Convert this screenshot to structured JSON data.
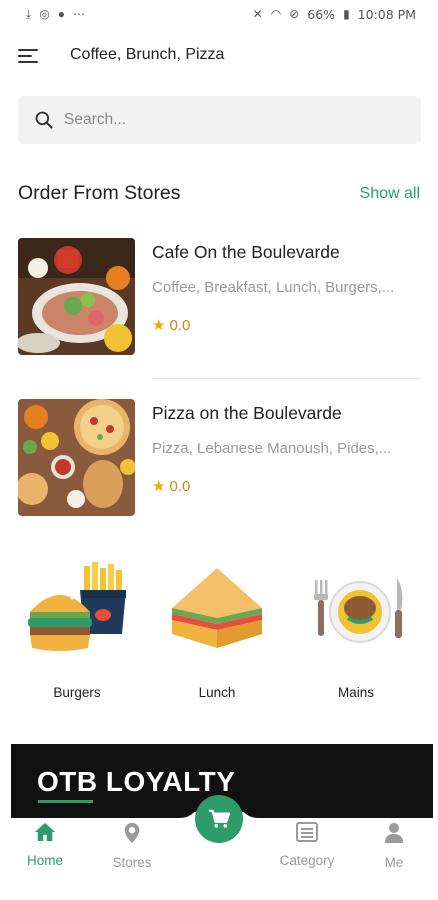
{
  "status_bar": {
    "left_icons": [
      "download-icon",
      "messenger-icon",
      "android-icon",
      "more-dots-icon"
    ],
    "right_icons": [
      "mute-icon",
      "wifi-icon",
      "no-disturb-icon",
      "battery-icon"
    ],
    "battery": "66%",
    "time": "10:08 PM"
  },
  "header": {
    "menu_icon": "hamburger-menu-icon",
    "title": "Coffee, Brunch, Pizza"
  },
  "search": {
    "placeholder": "Search..."
  },
  "section": {
    "title": "Order From Stores",
    "show_all": "Show all"
  },
  "stores": [
    {
      "name": "Cafe On the Boulevarde",
      "tags": "Coffee, Breakfast, Lunch, Burgers,...",
      "rating": "0.0"
    },
    {
      "name": "Pizza on the Boulevarde",
      "tags": "Pizza, Lebanese Manoush, Pides,...",
      "rating": "0.0"
    }
  ],
  "categories": [
    {
      "label": "Burgers",
      "icon": "burger-fries-icon"
    },
    {
      "label": "Lunch",
      "icon": "sandwich-icon"
    },
    {
      "label": "Mains",
      "icon": "plate-cutlery-icon"
    }
  ],
  "loyalty": {
    "title": "OTB LOYALTY"
  },
  "bottom_nav": {
    "items": [
      {
        "label": "Home",
        "icon": "home-icon",
        "active": true
      },
      {
        "label": "Stores",
        "icon": "location-pin-icon",
        "active": false
      },
      {
        "label": "Category",
        "icon": "list-icon",
        "active": false
      },
      {
        "label": "Me",
        "icon": "user-icon",
        "active": false
      }
    ],
    "center_icon": "cart-icon"
  },
  "colors": {
    "accent": "#2e9b6a",
    "rating": "#d98310",
    "star": "#f2a900",
    "banner": "#111111"
  }
}
